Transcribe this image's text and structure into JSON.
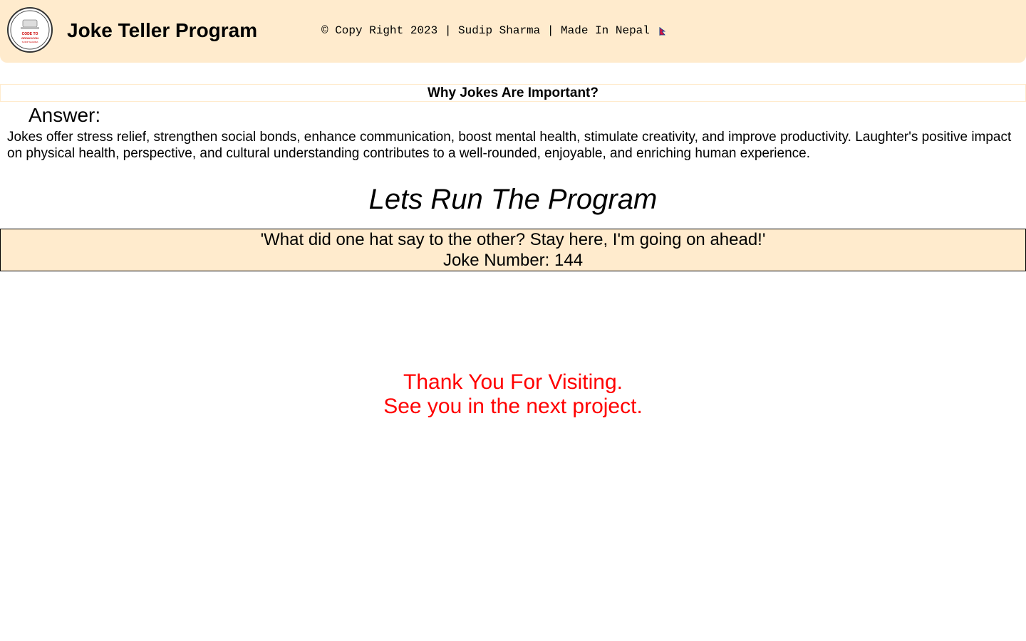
{
  "header": {
    "logo_icon": "code-to-grow-logo-icon",
    "logo_lines": [
      "CODE TO",
      "GROW ICON",
      "SUDIP SHARMA"
    ],
    "title": "Joke Teller Program",
    "copyright": "© Copy Right 2023 | Sudip Sharma | Made In Nepal",
    "flag_icon": "nepal-flag-icon",
    "background_color": "#ffebcd"
  },
  "faq": {
    "question": "Why Jokes Are Important?",
    "answer_label": "Answer:",
    "answer_text": "Jokes offer stress relief, strengthen social bonds, enhance communication, boost mental health, stimulate creativity, and improve productivity. Laughter's positive impact on physical health, perspective, and cultural understanding contributes to a well-rounded, enjoyable, and enriching human experience."
  },
  "program": {
    "title": "Lets Run The Program",
    "joke": "'What did one hat say to the other? Stay here, I'm going on ahead!'",
    "joke_number": "Joke Number: 144"
  },
  "footer": {
    "thanks_line1": "Thank You For Visiting.",
    "thanks_line2": "See you in the next project.",
    "accent_color": "#ff0000"
  }
}
